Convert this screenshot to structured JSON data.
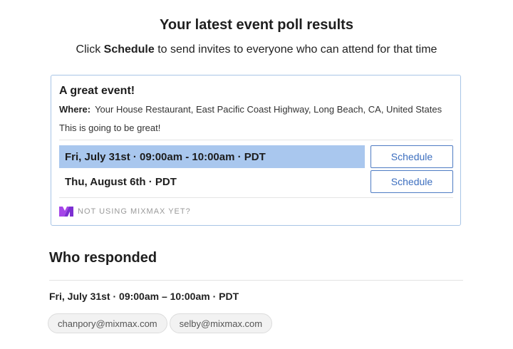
{
  "header": {
    "title": "Your latest event poll results",
    "subtitle_prefix": "Click ",
    "subtitle_bold": "Schedule",
    "subtitle_suffix": " to send invites to everyone who can attend for that time"
  },
  "event": {
    "title": "A great event!",
    "where_label": "Where:",
    "where_value": "Your House Restaurant, East Pacific Coast Highway, Long Beach, CA, United States",
    "description": "This is going to be great!",
    "times": [
      {
        "label": "Fri, July 31st · 09:00am - 10:00am · PDT",
        "button": "Schedule",
        "selected": true
      },
      {
        "label": "Thu, August 6th · PDT",
        "button": "Schedule",
        "selected": false
      }
    ],
    "footer_text": "NOT USING MIXMAX YET?",
    "brand_color": "#a546e8"
  },
  "responses": {
    "heading": "Who responded",
    "slot_label": "Fri, July 31st · 09:00am – 10:00am · PDT",
    "emails": [
      "chanpory@mixmax.com",
      "selby@mixmax.com"
    ]
  }
}
